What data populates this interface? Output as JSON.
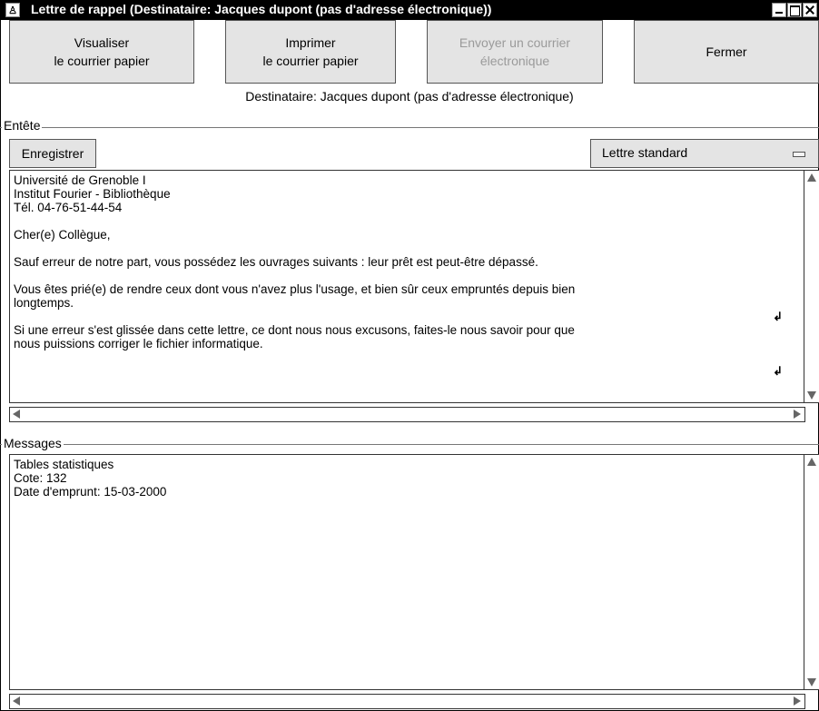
{
  "window": {
    "title": "Lettre de rappel (Destinataire: Jacques dupont (pas d'adresse électronique))"
  },
  "toolbar": {
    "view_label_line1": "Visualiser",
    "view_label_line2": "le courrier papier",
    "print_label_line1": "Imprimer",
    "print_label_line2": "le courrier papier",
    "email_label_line1": "Envoyer un courrier",
    "email_label_line2": "électronique",
    "close_label": "Fermer"
  },
  "recipient_line": "Destinataire: Jacques dupont (pas d'adresse électronique)",
  "header_group": {
    "label": "Entête",
    "save_label": "Enregistrer",
    "template_select_value": "Lettre standard"
  },
  "letter": {
    "lines": [
      "Université de Grenoble I",
      "Institut Fourier - Bibliothèque",
      "Tél. 04-76-51-44-54",
      "Cher(e) Collègue,",
      "Sauf erreur de notre part, vous possédez les ouvrages suivants : leur prêt est peut-être dépassé.",
      "Vous êtes prié(e) de rendre ceux dont vous n'avez plus l'usage, et bien sûr ceux empruntés depuis bien",
      "longtemps.",
      "Si une erreur s'est glissée dans cette lettre, ce dont nous nous excusons, faites-le nous savoir pour que",
      "nous puissions corriger le fichier informatique."
    ],
    "wrap_mark": "↲"
  },
  "messages_group": {
    "label": "Messages",
    "lines": [
      "Tables statistiques",
      "Cote: 132",
      "Date d'emprunt: 15-03-2000"
    ]
  }
}
